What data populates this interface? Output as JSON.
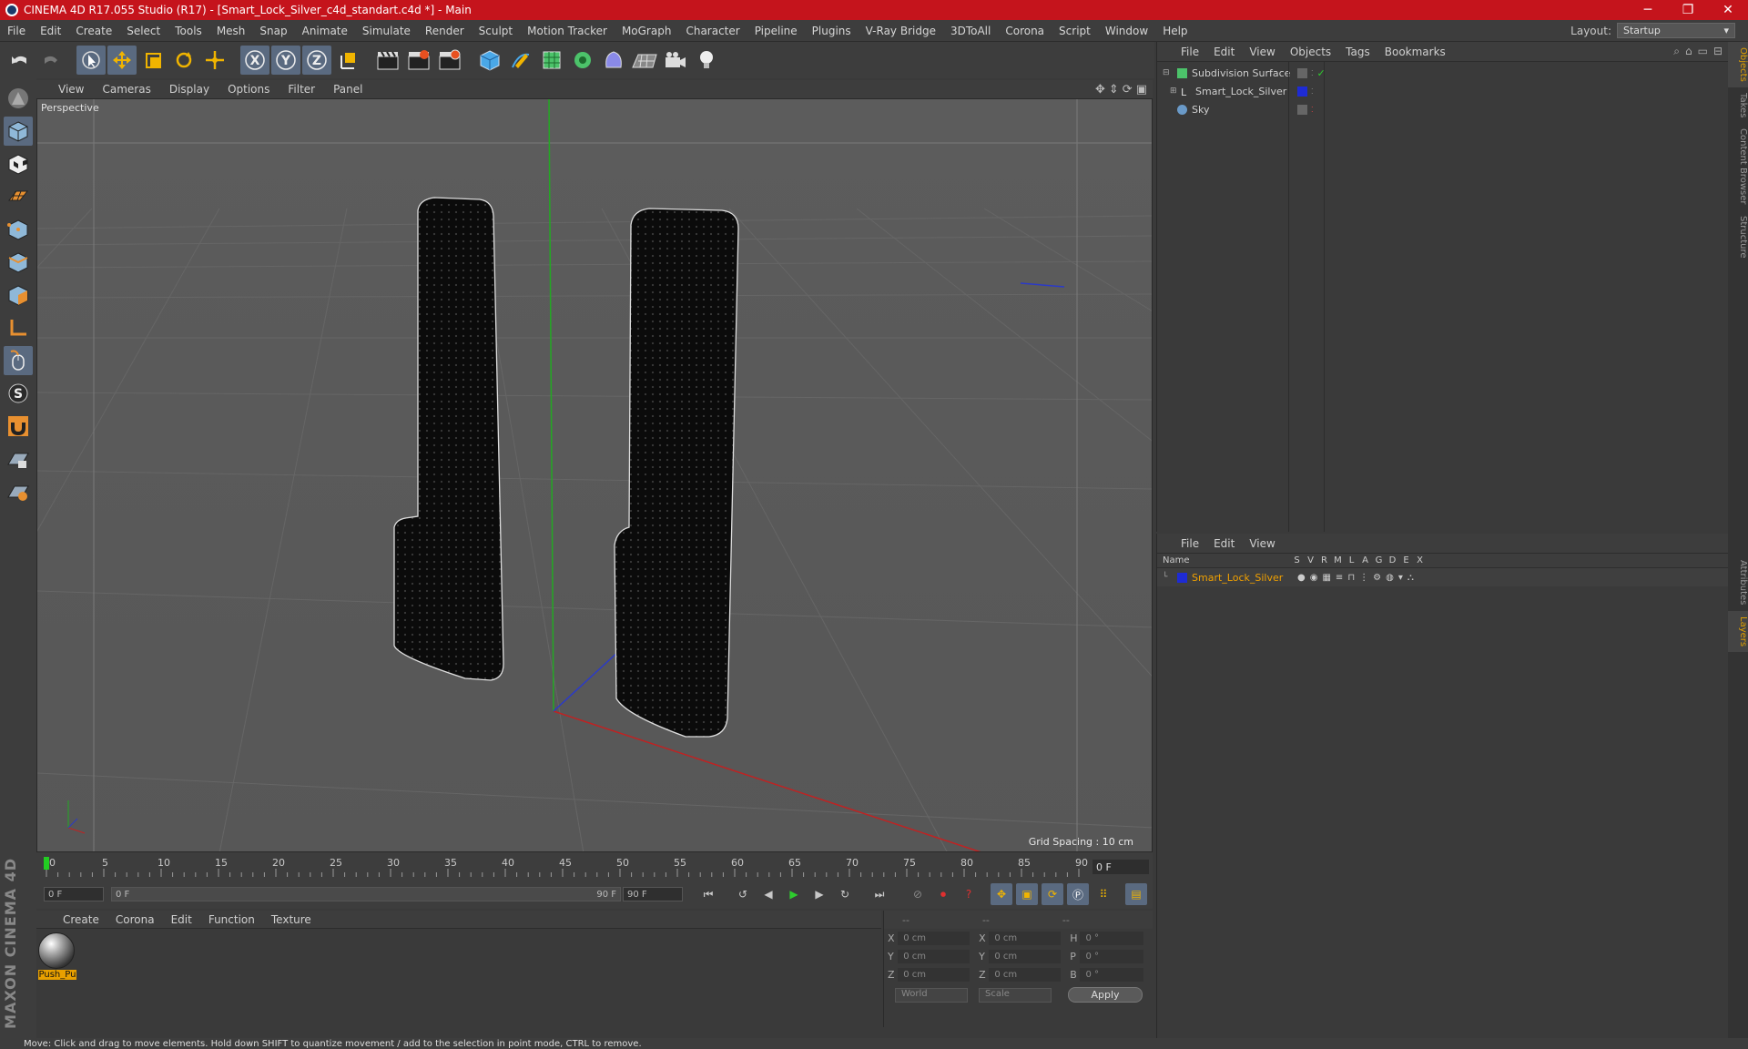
{
  "titlebar": {
    "title": "CINEMA 4D R17.055 Studio (R17) - [Smart_Lock_Silver_c4d_standart.c4d *] - Main",
    "min": "─",
    "max": "❐",
    "close": "✕"
  },
  "menubar": {
    "items": [
      "File",
      "Edit",
      "Create",
      "Select",
      "Tools",
      "Mesh",
      "Snap",
      "Animate",
      "Simulate",
      "Render",
      "Sculpt",
      "Motion Tracker",
      "MoGraph",
      "Character",
      "Pipeline",
      "Plugins",
      "V-Ray Bridge",
      "3DToAll",
      "Corona",
      "Script",
      "Window",
      "Help"
    ],
    "layout_label": "Layout:",
    "layout_value": "Startup"
  },
  "viewport": {
    "menu": [
      "View",
      "Cameras",
      "Display",
      "Options",
      "Filter",
      "Panel"
    ],
    "label": "Perspective",
    "grid_spacing": "Grid Spacing : 10 cm"
  },
  "timeline": {
    "ticks": [
      "0",
      "5",
      "10",
      "15",
      "20",
      "25",
      "30",
      "35",
      "40",
      "45",
      "50",
      "55",
      "60",
      "65",
      "70",
      "75",
      "80",
      "85",
      "90"
    ],
    "current_frame": "0 F"
  },
  "playbar": {
    "start": "0 F",
    "range_start": "0 F",
    "range_end": "90 F",
    "end": "90 F"
  },
  "material_manager": {
    "menu": [
      "Create",
      "Corona",
      "Edit",
      "Function",
      "Texture"
    ],
    "material_name": "Push_Pu"
  },
  "coords": {
    "headers": [
      "--",
      "--",
      "--"
    ],
    "rows": [
      {
        "a": "X",
        "v1": "0 cm",
        "b": "X",
        "v2": "0 cm",
        "c": "H",
        "v3": "0 °"
      },
      {
        "a": "Y",
        "v1": "0 cm",
        "b": "Y",
        "v2": "0 cm",
        "c": "P",
        "v3": "0 °"
      },
      {
        "a": "Z",
        "v1": "0 cm",
        "b": "Z",
        "v2": "0 cm",
        "c": "B",
        "v3": "0 °"
      }
    ],
    "mode1": "World",
    "mode2": "Scale",
    "apply": "Apply"
  },
  "object_manager": {
    "menu": [
      "File",
      "Edit",
      "View",
      "Objects",
      "Tags",
      "Bookmarks"
    ],
    "objects": [
      {
        "name": "Subdivision Surface"
      },
      {
        "name": "Smart_Lock_Silver"
      },
      {
        "name": "Sky"
      }
    ]
  },
  "layer_manager": {
    "menu": [
      "File",
      "Edit",
      "View"
    ],
    "name_header": "Name",
    "col_headers": [
      "S",
      "V",
      "R",
      "M",
      "L",
      "A",
      "G",
      "D",
      "E",
      "X"
    ],
    "layer_name": "Smart_Lock_Silver"
  },
  "right_tabs": [
    "Objects",
    "Takes",
    "Content Browser",
    "Structure",
    "Attributes",
    "Layers"
  ],
  "brand": "MAXON CINEMA 4D",
  "status": "Move: Click and drag to move elements. Hold down SHIFT to quantize movement / add to the selection in point mode, CTRL to remove.",
  "colors": {
    "title_red": "#c5141c",
    "selected_tool": "#5a6a80",
    "accent_orange": "#e8a000",
    "layer_blue": "#1e2bd4"
  }
}
